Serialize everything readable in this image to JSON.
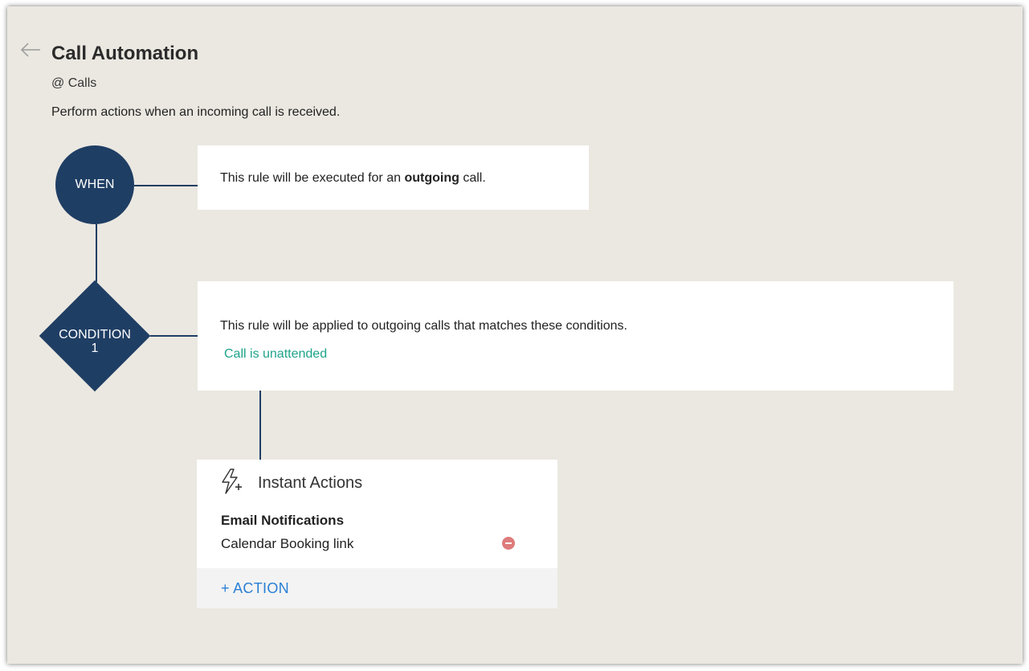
{
  "header": {
    "title": "Call Automation",
    "subtitle": "@ Calls",
    "description": "Perform actions when an incoming call is received.",
    "back_icon": "arrow-left-icon"
  },
  "when": {
    "node_label": "WHEN",
    "text_before": "This rule will be executed for an ",
    "text_bold": "outgoing",
    "text_after": " call."
  },
  "condition": {
    "node_label": "CONDITION",
    "node_number": "1",
    "text": "This rule will be applied to outgoing calls that matches these conditions.",
    "item": "Call is unattended"
  },
  "instant_actions": {
    "title": "Instant Actions",
    "icon": "lightning-plus-icon",
    "group_title": "Email Notifications",
    "item": "Calendar Booking link",
    "remove_icon": "remove-circle-icon",
    "add_action_label": "+ ACTION"
  },
  "colors": {
    "node": "#1f3e64",
    "condition_item": "#1ea38b",
    "add_action": "#2a7fd4",
    "remove": "#de7b7b",
    "background": "#ebe8e1"
  }
}
